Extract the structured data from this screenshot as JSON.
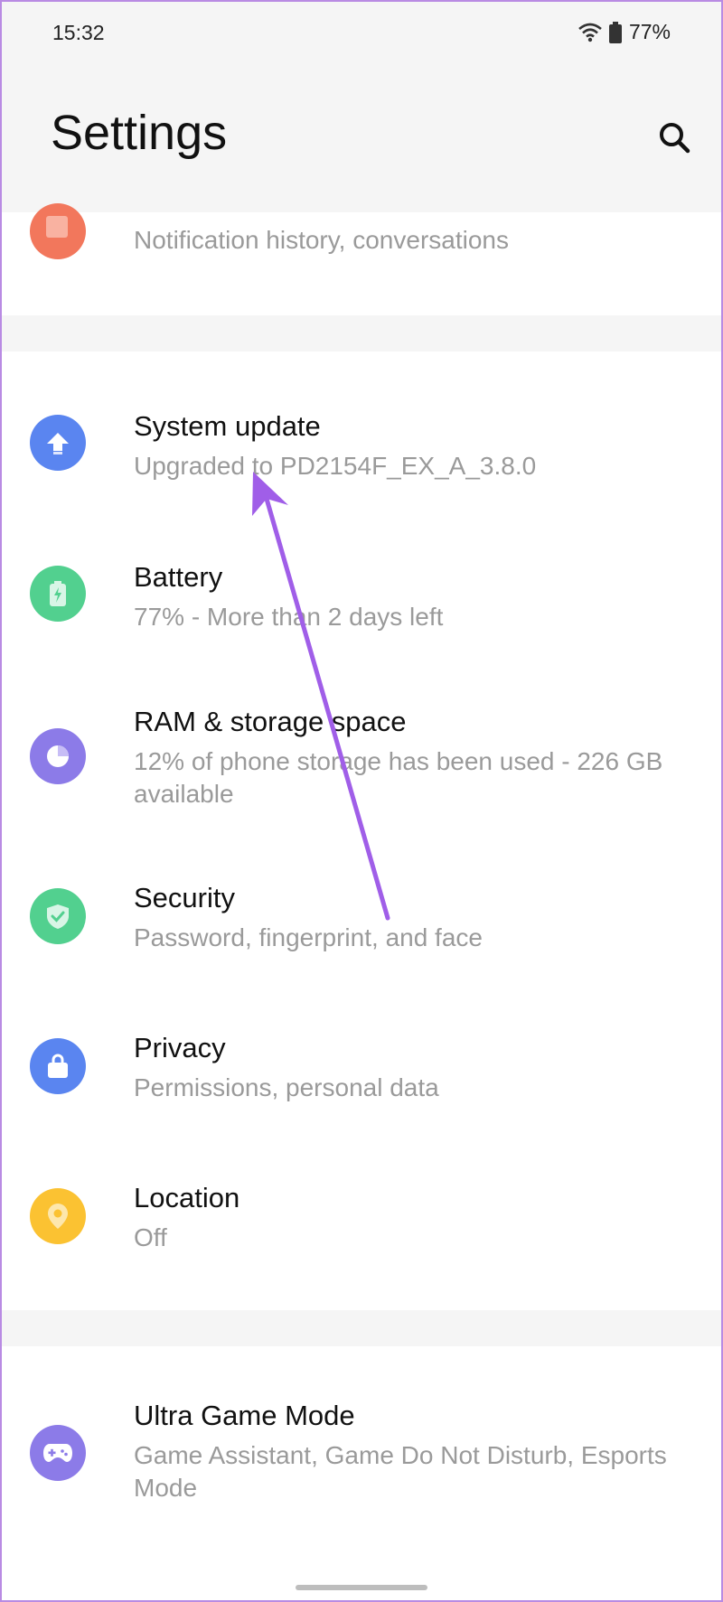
{
  "status_bar": {
    "time": "15:32",
    "battery_text": "77%",
    "icons": [
      "wifi-icon",
      "battery-icon"
    ]
  },
  "header": {
    "title": "Settings",
    "search_icon": "search-icon"
  },
  "partial_item": {
    "subtitle": "Notification history, conversations",
    "icon": "notification-icon",
    "color": "#f2775c"
  },
  "group1": [
    {
      "title": "System update",
      "subtitle": "Upgraded to PD2154F_EX_A_3.8.0",
      "icon": "upload-arrow-icon",
      "color": "#5a85f0"
    },
    {
      "title": "Battery",
      "subtitle": "77% - More than 2 days left",
      "icon": "battery-icon",
      "color": "#52d08f"
    },
    {
      "title": "RAM & storage space",
      "subtitle": "12% of phone storage has been used - 226 GB available",
      "icon": "storage-pie-icon",
      "color": "#8c7be8"
    },
    {
      "title": "Security",
      "subtitle": "Password, fingerprint, and face",
      "icon": "shield-icon",
      "color": "#52d08f"
    },
    {
      "title": "Privacy",
      "subtitle": "Permissions, personal data",
      "icon": "lock-icon",
      "color": "#5a85f0"
    },
    {
      "title": "Location",
      "subtitle": "Off",
      "icon": "location-pin-icon",
      "color": "#fbc232"
    }
  ],
  "group2": [
    {
      "title": "Ultra Game Mode",
      "subtitle": "Game Assistant, Game Do Not Disturb, Esports Mode",
      "icon": "gamepad-icon",
      "color": "#8c7be8"
    }
  ],
  "annotation": {
    "arrow_color": "#a05ee8"
  }
}
